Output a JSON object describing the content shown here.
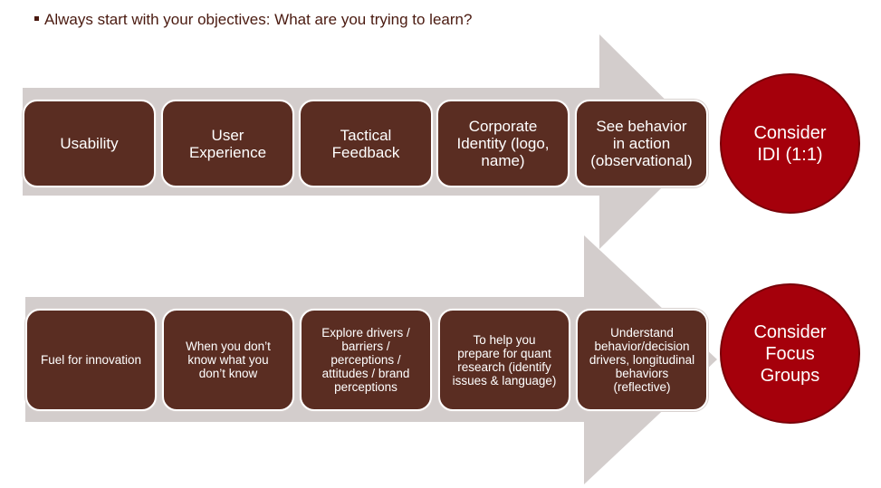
{
  "header": {
    "bullet_text": "Always start with your objectives:  What are you trying to learn?"
  },
  "rows": [
    {
      "boxes": [
        "Usability",
        "User\nExperience",
        "Tactical\nFeedback",
        "Corporate\nIdentity (logo,\nname)",
        "See behavior\nin action\n(observational)"
      ],
      "conclusion": "Consider\nIDI (1:1)"
    },
    {
      "boxes": [
        "Fuel for innovation",
        "When you don’t\nknow what you\ndon’t know",
        "Explore drivers /\nbarriers /\nperceptions /\nattitudes / brand\nperceptions",
        "To help you\nprepare for quant\nresearch (identify\nissues & language)",
        "Understand\nbehavior/decision\ndrivers, longitudinal\nbehaviors\n(reflective)"
      ],
      "conclusion": "Consider\nFocus\nGroups"
    }
  ],
  "colors": {
    "box_fill": "#5a2d22",
    "arrow_fill": "#d3cdcc",
    "circle_fill": "#a5000b",
    "header_text": "#4a1a10"
  }
}
